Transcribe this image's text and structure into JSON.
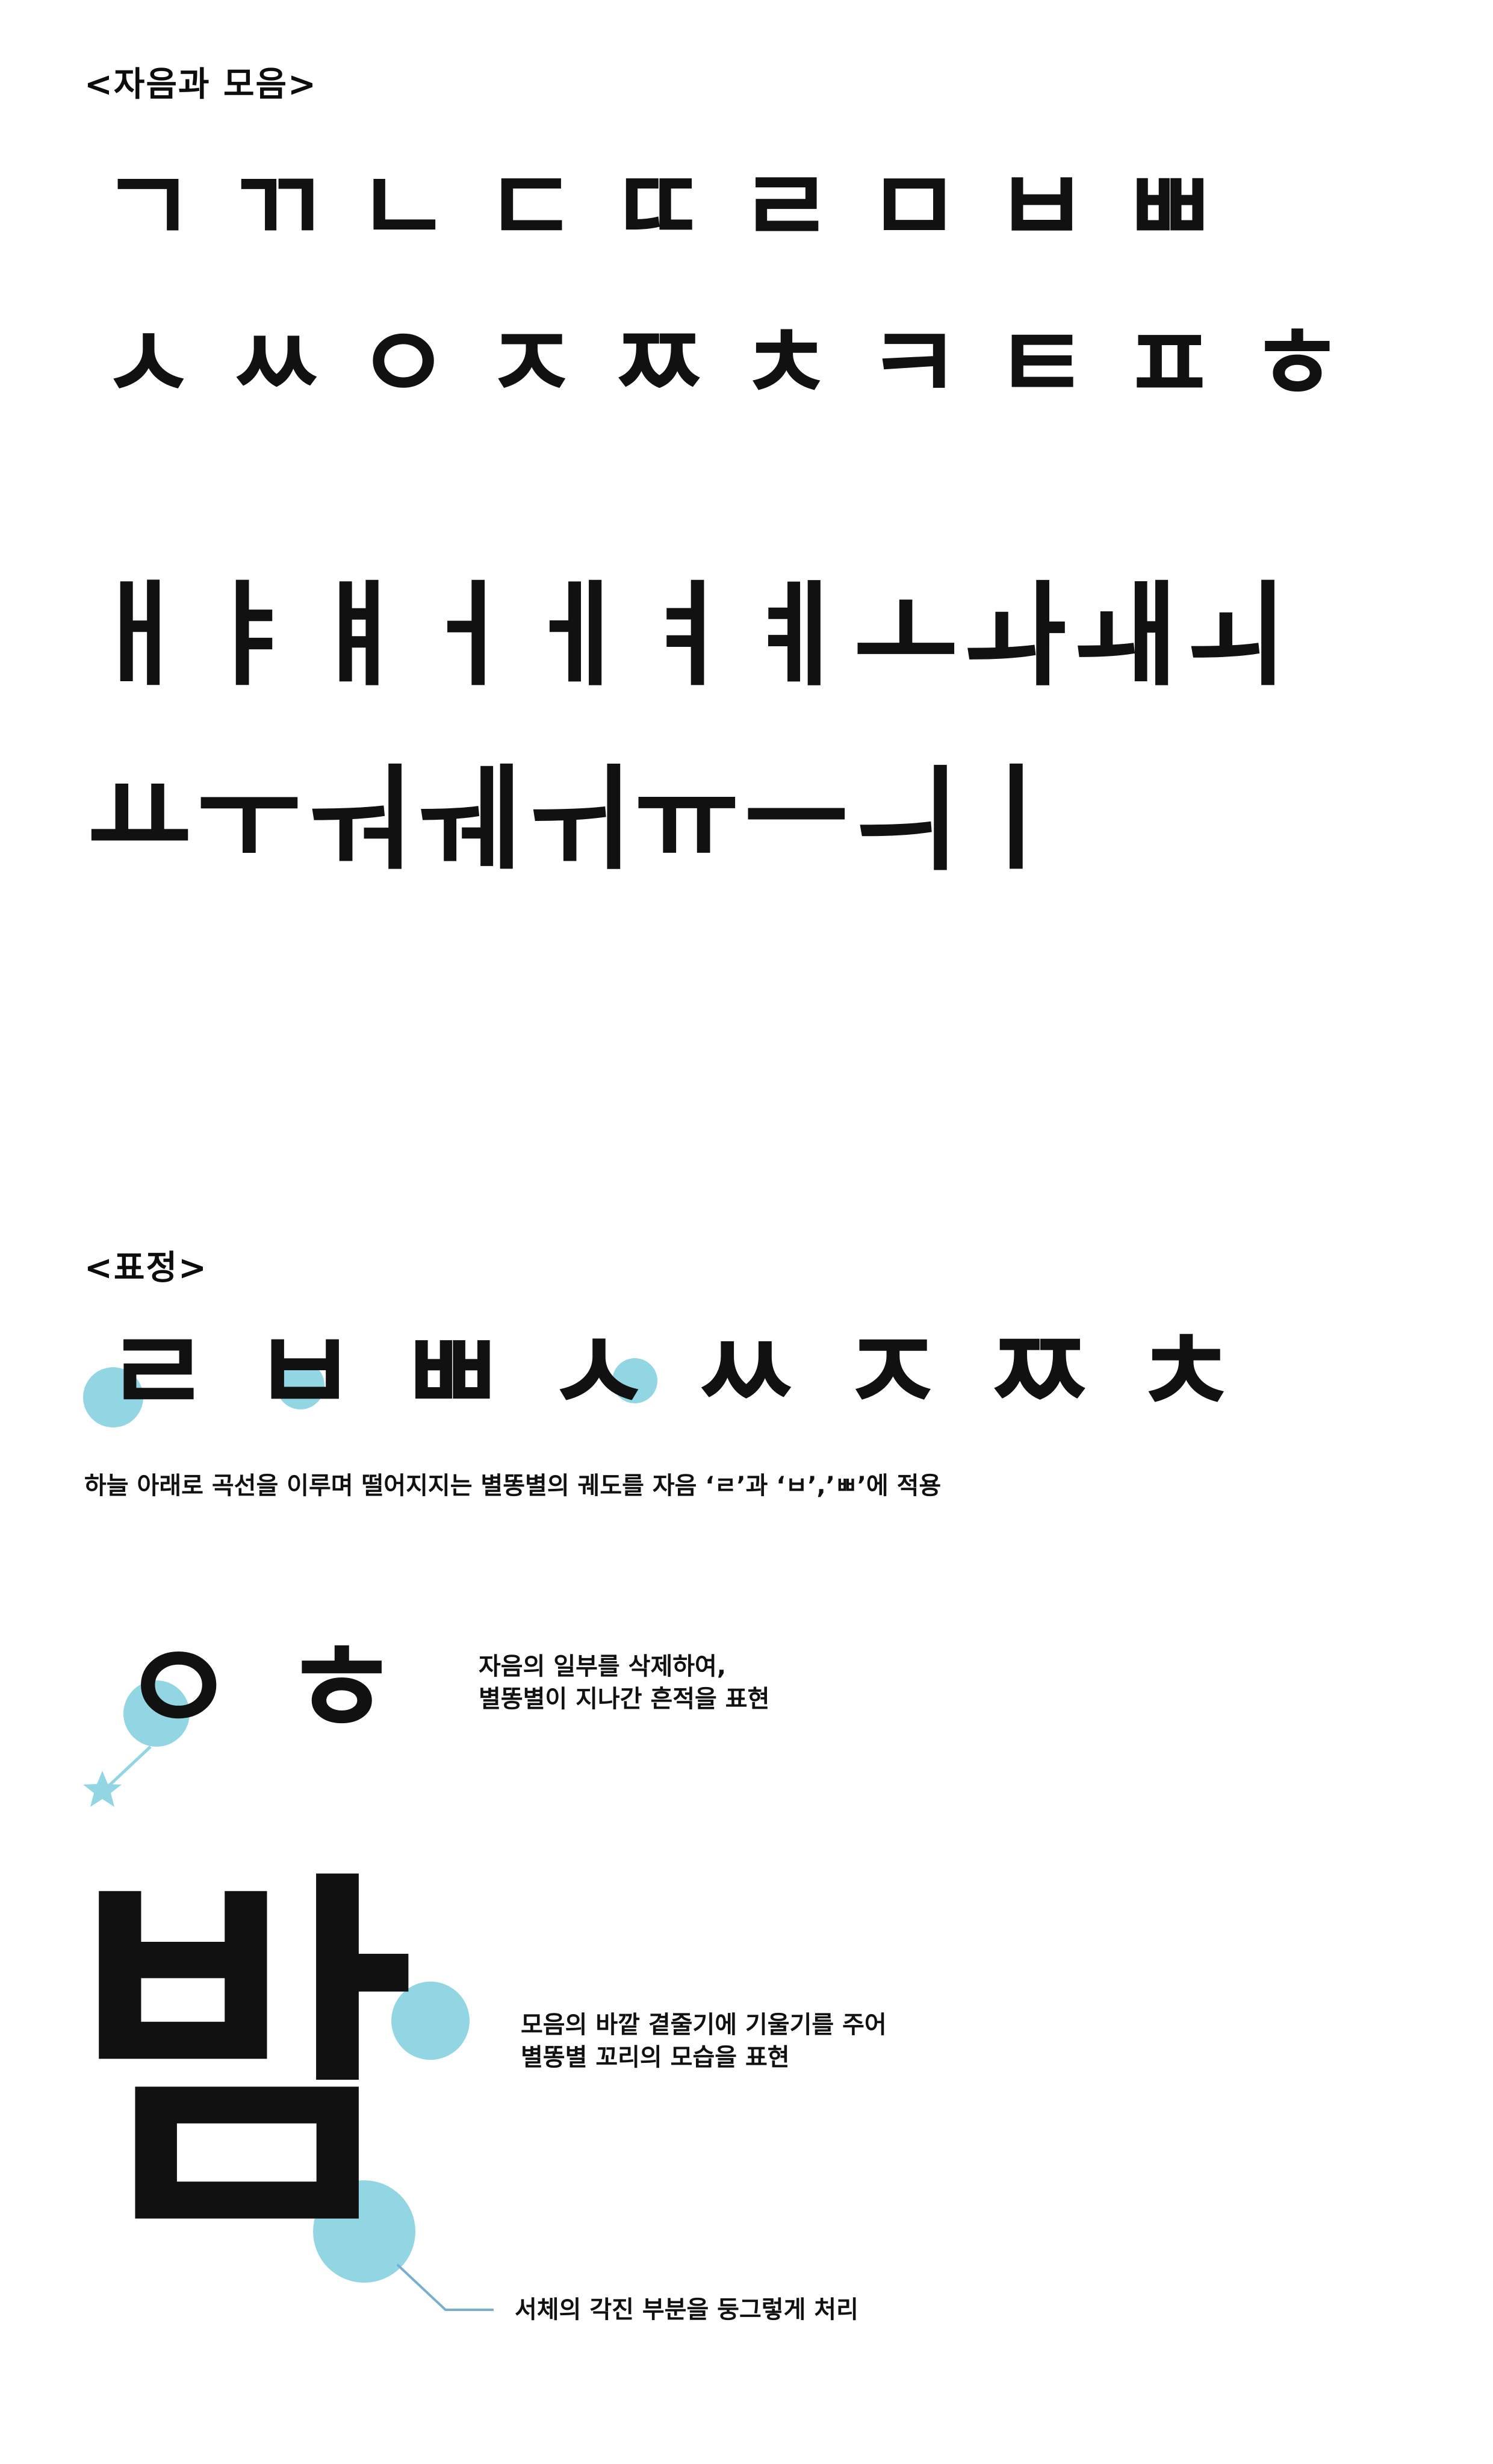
{
  "section_consonants_vowels": {
    "heading": "<자음과 모음>",
    "consonant_row_1": [
      "ㄱ",
      "ㄲ",
      "ㄴ",
      "ㄷ",
      "ㄸ",
      "ㄹ",
      "ㅁ",
      "ㅂ",
      "ㅃ"
    ],
    "consonant_row_2": [
      "ㅅ",
      "ㅆ",
      "ㅇ",
      "ㅈ",
      "ㅉ",
      "ㅊ",
      "ㅋ",
      "ㅌ",
      "ㅍ",
      "ㅎ"
    ],
    "vowel_row_1": [
      "ㅐ",
      "ㅑ",
      "ㅒ",
      "ㅓ",
      "ㅔ",
      "ㅕ",
      "ㅖ",
      "ㅗ",
      "ㅘ",
      "ㅙ",
      "ㅚ"
    ],
    "vowel_row_2": [
      "ㅛ",
      "ㅜ",
      "ㅝ",
      "ㅞ",
      "ㅟ",
      "ㅠ",
      "ㅡ",
      "ㅢ",
      "ㅣ"
    ]
  },
  "section_expression": {
    "heading": "<표정>",
    "expression_glyphs": [
      "ㄹ",
      "ㅂ",
      "ㅃ",
      "ㅅ",
      "ㅆ",
      "ㅈ",
      "ㅉ",
      "ㅊ"
    ],
    "caption_trajectory": "하늘 아래로 곡선을 이루며 떨어지지는 별똥별의 궤도를 자음 ‘ㄹ’과 ‘ㅂ’,’ㅃ’에 적용",
    "sample_oh": [
      "ㅇ",
      "ㅎ"
    ],
    "caption_trace_line1": "자음의 일부를 삭제하여,",
    "caption_trace_line2": "별똥별이 지나간 흔적을 표현",
    "big_syllable": "밤",
    "caption_tail_line1": "모음의 바깥 곁줄기에 기울기를 주어",
    "caption_tail_line2": "별똥별 꼬리의 모습을 표현",
    "caption_round": "서체의 각진 부분을 둥그렇게 처리"
  },
  "colors": {
    "accent_cyan": "#93d6e3",
    "glyph_black": "#111111",
    "leader_blue": "#7aaed0"
  },
  "icons": [
    "star-icon"
  ]
}
